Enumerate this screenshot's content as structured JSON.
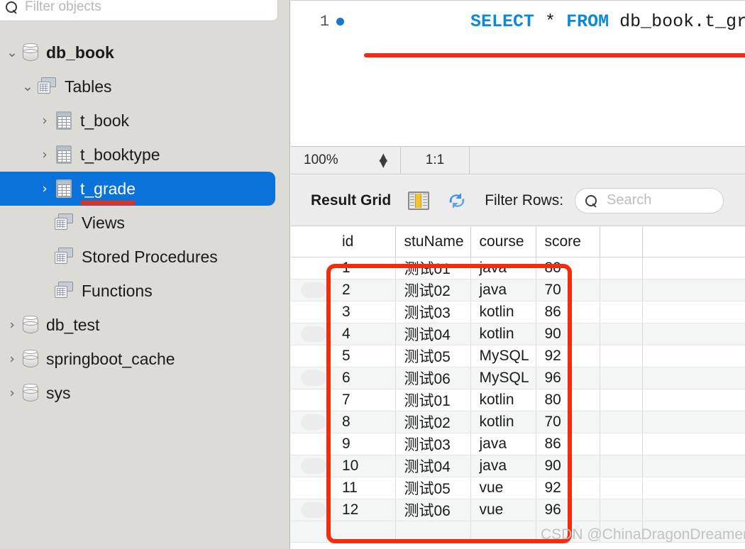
{
  "sidebar": {
    "filter": {
      "placeholder": "Filter objects",
      "value": "",
      "icon": "search-icon"
    },
    "tree": [
      {
        "label": "db_book",
        "icon": "database-icon",
        "twisty": "⌄",
        "depth": 0,
        "bold": true,
        "selected": false
      },
      {
        "label": "Tables",
        "icon": "schema-folder-icon",
        "twisty": "⌄",
        "depth": 1,
        "bold": false,
        "selected": false
      },
      {
        "label": "t_book",
        "icon": "table-icon",
        "twisty": "›",
        "depth": 2,
        "bold": false,
        "selected": false
      },
      {
        "label": "t_booktype",
        "icon": "table-icon",
        "twisty": "›",
        "depth": 2,
        "bold": false,
        "selected": false
      },
      {
        "label": "t_grade",
        "icon": "table-icon",
        "twisty": "›",
        "depth": 2,
        "bold": false,
        "selected": true
      },
      {
        "label": "Views",
        "icon": "schema-folder-icon",
        "twisty": "",
        "depth": 2,
        "bold": false,
        "selected": false
      },
      {
        "label": "Stored Procedures",
        "icon": "schema-folder-icon",
        "twisty": "",
        "depth": 2,
        "bold": false,
        "selected": false
      },
      {
        "label": "Functions",
        "icon": "schema-folder-icon",
        "twisty": "",
        "depth": 2,
        "bold": false,
        "selected": false
      },
      {
        "label": "db_test",
        "icon": "database-icon",
        "twisty": "›",
        "depth": 0,
        "bold": false,
        "selected": false
      },
      {
        "label": "springboot_cache",
        "icon": "database-icon",
        "twisty": "›",
        "depth": 0,
        "bold": false,
        "selected": false
      },
      {
        "label": "sys",
        "icon": "database-icon",
        "twisty": "›",
        "depth": 0,
        "bold": false,
        "selected": false
      }
    ]
  },
  "editor": {
    "line_number": "1",
    "sql_tokens": [
      {
        "text": "SELECT",
        "type": "keyword"
      },
      {
        "text": " * ",
        "type": "plain"
      },
      {
        "text": "FROM",
        "type": "keyword"
      },
      {
        "text": " db_book.t_grade;",
        "type": "plain"
      }
    ]
  },
  "status_strip": {
    "zoom": "100%",
    "ratio": "1:1"
  },
  "grid_toolbar": {
    "title": "Result Grid",
    "fieldtypes_icon": "field-types-icon",
    "refresh_icon": "refresh-icon",
    "filter_rows_label": "Filter Rows:",
    "search": {
      "placeholder": "Search",
      "value": "",
      "icon": "search-icon"
    }
  },
  "result_table": {
    "columns": [
      "id",
      "stuName",
      "course",
      "score"
    ],
    "rows": [
      {
        "id": "1",
        "stuName": "测试01",
        "course": "java",
        "score": "80"
      },
      {
        "id": "2",
        "stuName": "测试02",
        "course": "java",
        "score": "70"
      },
      {
        "id": "3",
        "stuName": "测试03",
        "course": "kotlin",
        "score": "86"
      },
      {
        "id": "4",
        "stuName": "测试04",
        "course": "kotlin",
        "score": "90"
      },
      {
        "id": "5",
        "stuName": "测试05",
        "course": "MySQL",
        "score": "92"
      },
      {
        "id": "6",
        "stuName": "测试06",
        "course": "MySQL",
        "score": "96"
      },
      {
        "id": "7",
        "stuName": "测试01",
        "course": "kotlin",
        "score": "80"
      },
      {
        "id": "8",
        "stuName": "测试02",
        "course": "kotlin",
        "score": "70"
      },
      {
        "id": "9",
        "stuName": "测试03",
        "course": "java",
        "score": "86"
      },
      {
        "id": "10",
        "stuName": "测试04",
        "course": "java",
        "score": "90"
      },
      {
        "id": "11",
        "stuName": "测试05",
        "course": "vue",
        "score": "92"
      },
      {
        "id": "12",
        "stuName": "测试06",
        "course": "vue",
        "score": "96"
      }
    ]
  },
  "watermark": {
    "text": "CSDN @ChinaDragonDreamer"
  },
  "colors": {
    "selection_blue": "#0a72d8",
    "annotation_red": "#f42b0c",
    "keyword_blue": "#0d8ad6",
    "sidebar_bg": "#dddbd6",
    "row_stripe": "#f4f5f5"
  }
}
